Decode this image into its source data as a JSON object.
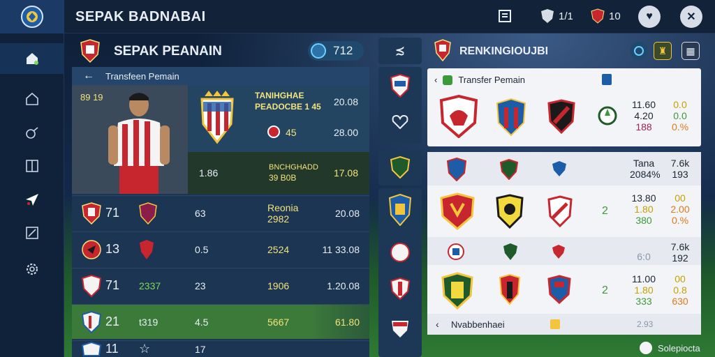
{
  "app": {
    "title": "SEPAK BADNABAI"
  },
  "topbar": {
    "stat1": "1/1",
    "stat2": "10",
    "close_icon": "close-icon"
  },
  "left_panel": {
    "title": "SEPAK PEANAIN",
    "coins": "712",
    "transfer_label": "Transfeen Pemain",
    "player": {
      "rating": "89 19",
      "club_name_1": "TANIHGHAE",
      "club_name_2": "PEADOCBE 1 45",
      "value_1": "20.08",
      "stat_a": "45",
      "value_2": "28.00",
      "stat_b": "1.86",
      "club_sub_1": "BNCHGHADD",
      "club_sub_2": "39 B0B",
      "value_3": "17.08"
    },
    "rows": [
      {
        "num": "71",
        "mid": "63",
        "name": "Reonia",
        "name2": "2982",
        "value": "20.08"
      },
      {
        "num": "13",
        "mid": "0.5",
        "name": "2524",
        "name2": "",
        "value": "11 33.08"
      },
      {
        "num": "71",
        "extra": "2337",
        "mid": "23",
        "name": "1906",
        "name2": "",
        "value": "1.20.08"
      },
      {
        "num": "21",
        "extra": "t319",
        "mid": "4.5",
        "name": "5667",
        "name2": "",
        "value": "61.80"
      },
      {
        "num": "11",
        "mid": "17",
        "name": "",
        "name2": "",
        "value": ""
      }
    ]
  },
  "right_panel": {
    "title": "RENKINGIOUJBI",
    "transfer_label": "Transfer Pemain",
    "card1_stats": {
      "a1": "11.60",
      "a2": "4.20",
      "a3": "188",
      "b1": "0.0",
      "b2": "0.0",
      "b3": "0.%"
    },
    "section2_head": {
      "left": "Tana",
      "left2": "2084%",
      "right": "7.6k",
      "right2": "193"
    },
    "row2_stats": {
      "a1": "13.80",
      "a2": "1.80",
      "a3": "380",
      "b1": "00",
      "b2": "2.00",
      "b3": "0.%",
      "mid": "2"
    },
    "row3_head": {
      "left": "6:0",
      "right": "7.6k",
      "right2": "192"
    },
    "row4_stats": {
      "a1": "11.00",
      "a2": "1.80",
      "a3": "333",
      "b1": "00",
      "b2": "0.8",
      "b3": "630",
      "mid": "2"
    },
    "footer_label": "Nvabbenhaei",
    "footer_right": "2.93"
  },
  "bottom": {
    "label": "Solepiocta"
  },
  "colors": {
    "accent": "#2b73a8",
    "gold": "#f3e37a",
    "green_sel": "#3c7a3a",
    "red": "#c8262f"
  }
}
